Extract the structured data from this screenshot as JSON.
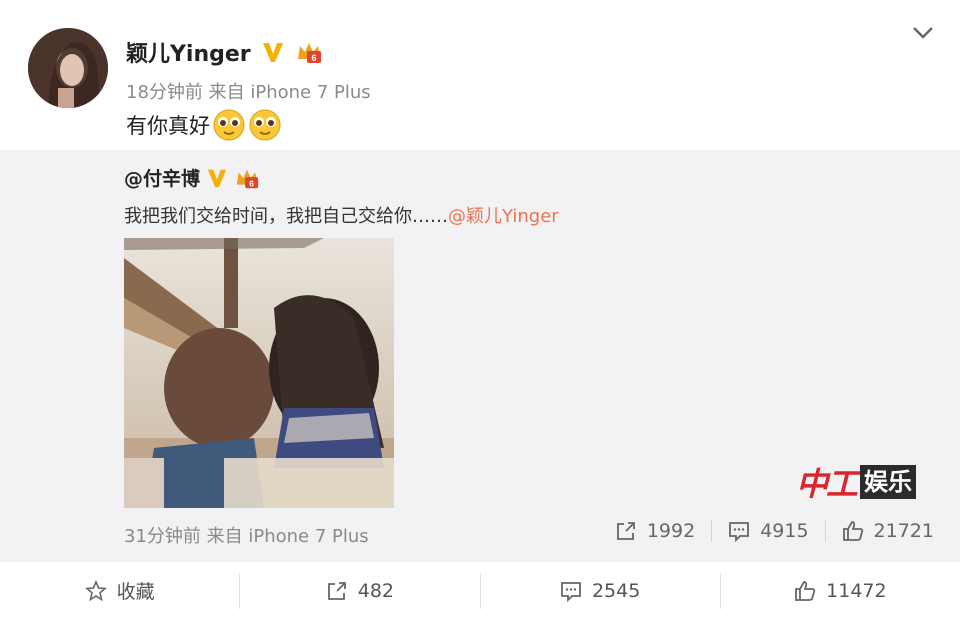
{
  "post": {
    "username": "颖儿Yinger",
    "meta": "18分钟前 来自 iPhone 7 Plus",
    "text": "有你真好",
    "emoji_icons": [
      "pleading-face-icon",
      "pleading-face-icon"
    ]
  },
  "repost": {
    "username": "@付辛博",
    "text": "我把我们交给时间，我把自己交给你……",
    "mention": "@颖儿Yinger",
    "meta": "31分钟前 来自 iPhone 7 Plus",
    "stats": {
      "share_count": "1992",
      "comment_count": "4915",
      "like_count": "21721"
    }
  },
  "watermark": {
    "left": "中工",
    "right": "娱乐"
  },
  "actions": {
    "favorite_label": "收藏",
    "share_count": "482",
    "comment_count": "2545",
    "like_count": "11472"
  },
  "colors": {
    "mention": "#eb7350",
    "verified_badge": "#f6b000",
    "repost_background": "#f2f2f5",
    "watermark_red": "#d8262c"
  }
}
